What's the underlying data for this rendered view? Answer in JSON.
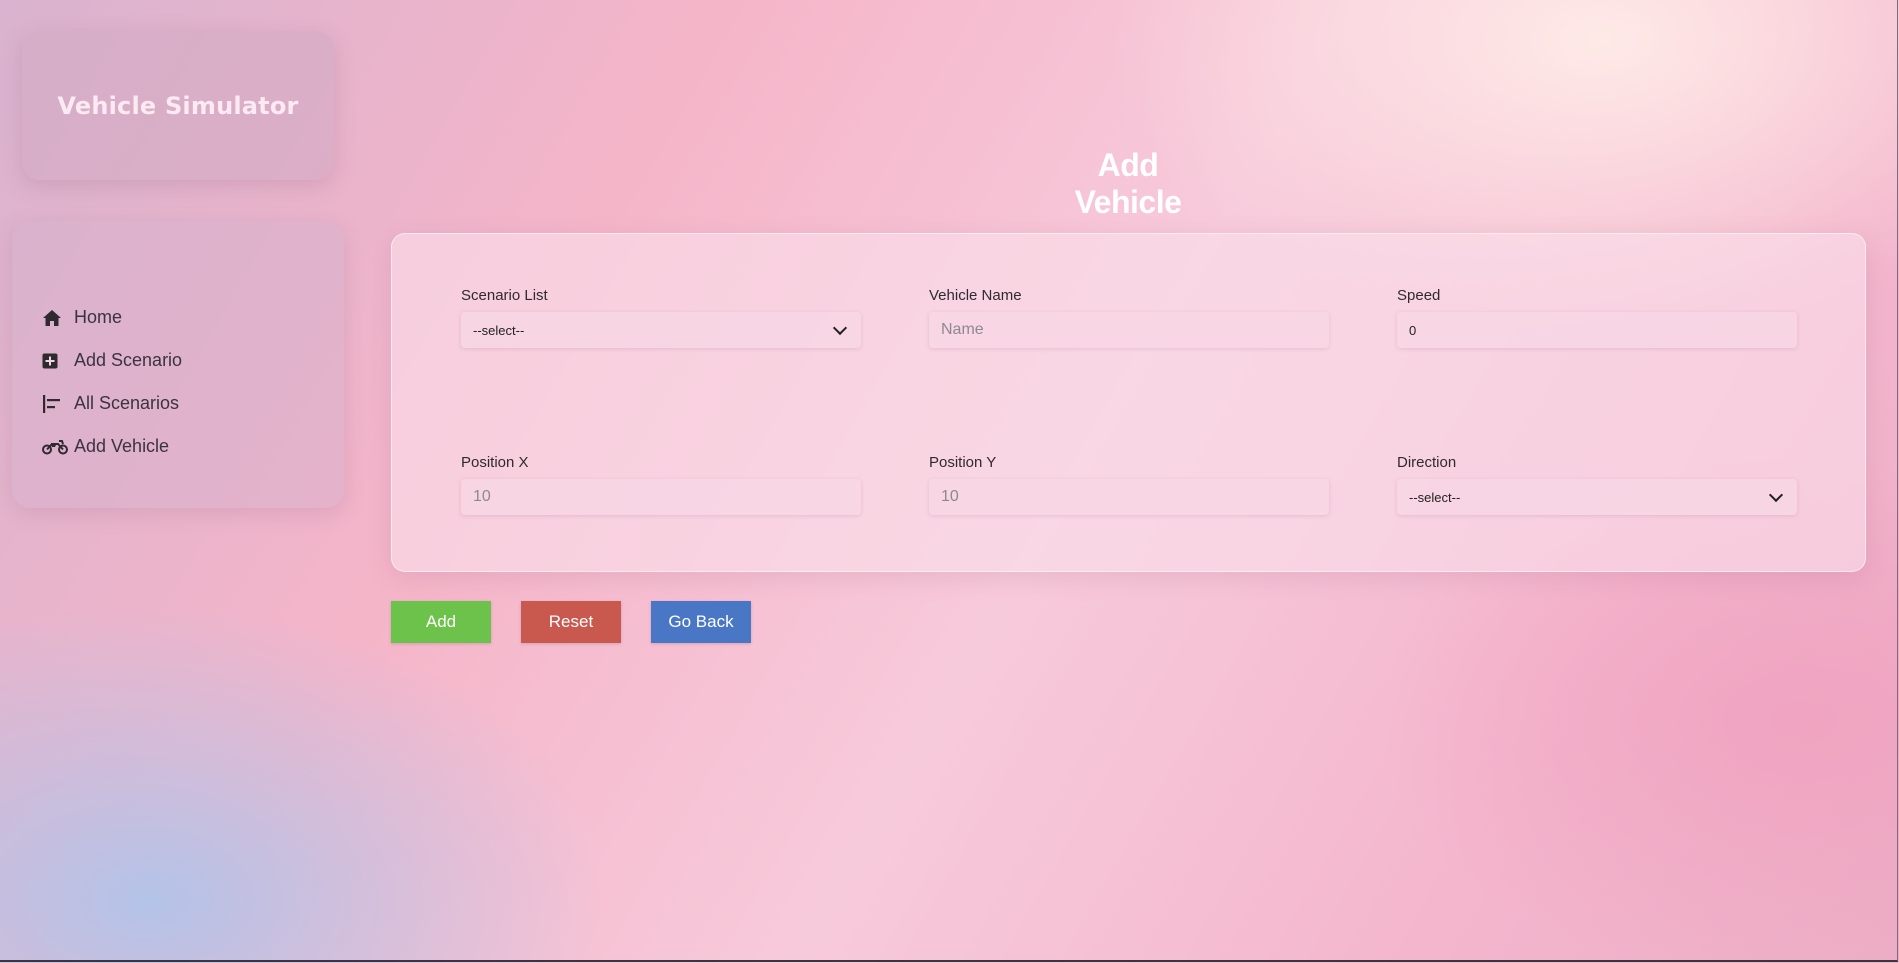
{
  "app": {
    "brand_title": "Vehicle Simulator"
  },
  "sidebar": {
    "items": [
      {
        "label": "Home",
        "icon": "home-icon"
      },
      {
        "label": "Add Scenario",
        "icon": "plus-square-icon"
      },
      {
        "label": "All Scenarios",
        "icon": "align-left-icon"
      },
      {
        "label": "Add Vehicle",
        "icon": "motorcycle-icon"
      }
    ]
  },
  "page": {
    "title": "Add Vehicle"
  },
  "form": {
    "scenario_list": {
      "label": "Scenario List",
      "value": "--select--"
    },
    "vehicle_name": {
      "label": "Vehicle Name",
      "placeholder": "Name"
    },
    "speed": {
      "label": "Speed",
      "value": "0"
    },
    "position_x": {
      "label": "Position X",
      "placeholder": "10"
    },
    "position_y": {
      "label": "Position Y",
      "placeholder": "10"
    },
    "direction": {
      "label": "Direction",
      "value": "--select--"
    }
  },
  "buttons": {
    "add": "Add",
    "reset": "Reset",
    "go_back": "Go Back"
  },
  "colors": {
    "add_button": "#6cc24a",
    "reset_button": "#c9584f",
    "go_back_button": "#4a76c6",
    "title_text": "#ffffff",
    "brand_text": "#fbeaf2"
  }
}
